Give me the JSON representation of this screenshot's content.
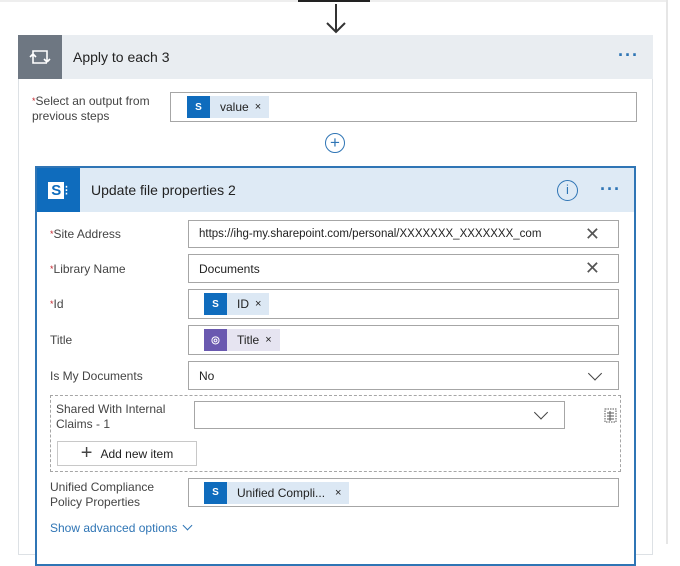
{
  "loop": {
    "title": "Apply to each 3",
    "more_label": "···",
    "field_label": "Select an output from previous steps",
    "token": "value",
    "token_remove": "×"
  },
  "add_step_label": "+",
  "action": {
    "title": "Update file properties 2",
    "info_label": "i",
    "more_label": "···",
    "fields": {
      "site_address": {
        "label": "Site Address",
        "value": "https://ihg-my.sharepoint.com/personal/XXXXXXX_XXXXXXX_com",
        "required": true
      },
      "library_name": {
        "label": "Library Name",
        "value": "Documents",
        "required": true
      },
      "id": {
        "label": "Id",
        "token": "ID",
        "required": true
      },
      "title": {
        "label": "Title",
        "token": "Title"
      },
      "is_my_documents": {
        "label": "Is My Documents",
        "value": "No"
      },
      "shared_with": {
        "label": "Shared With Internal Claims - 1",
        "value": ""
      },
      "add_new_item": "Add new item",
      "unified": {
        "label": "Unified Compliance Policy Properties",
        "token": "Unified Compli..."
      }
    },
    "show_advanced": "Show advanced options"
  },
  "required_marker": "*",
  "remove_glyph": "×",
  "clear_glyph": "✕",
  "colors": {
    "accent": "#2f75b5",
    "sharepoint": "#0f6cbd",
    "loop_icon": "#6e7782",
    "approval": "#6a59b0",
    "required": "#c4262e"
  }
}
